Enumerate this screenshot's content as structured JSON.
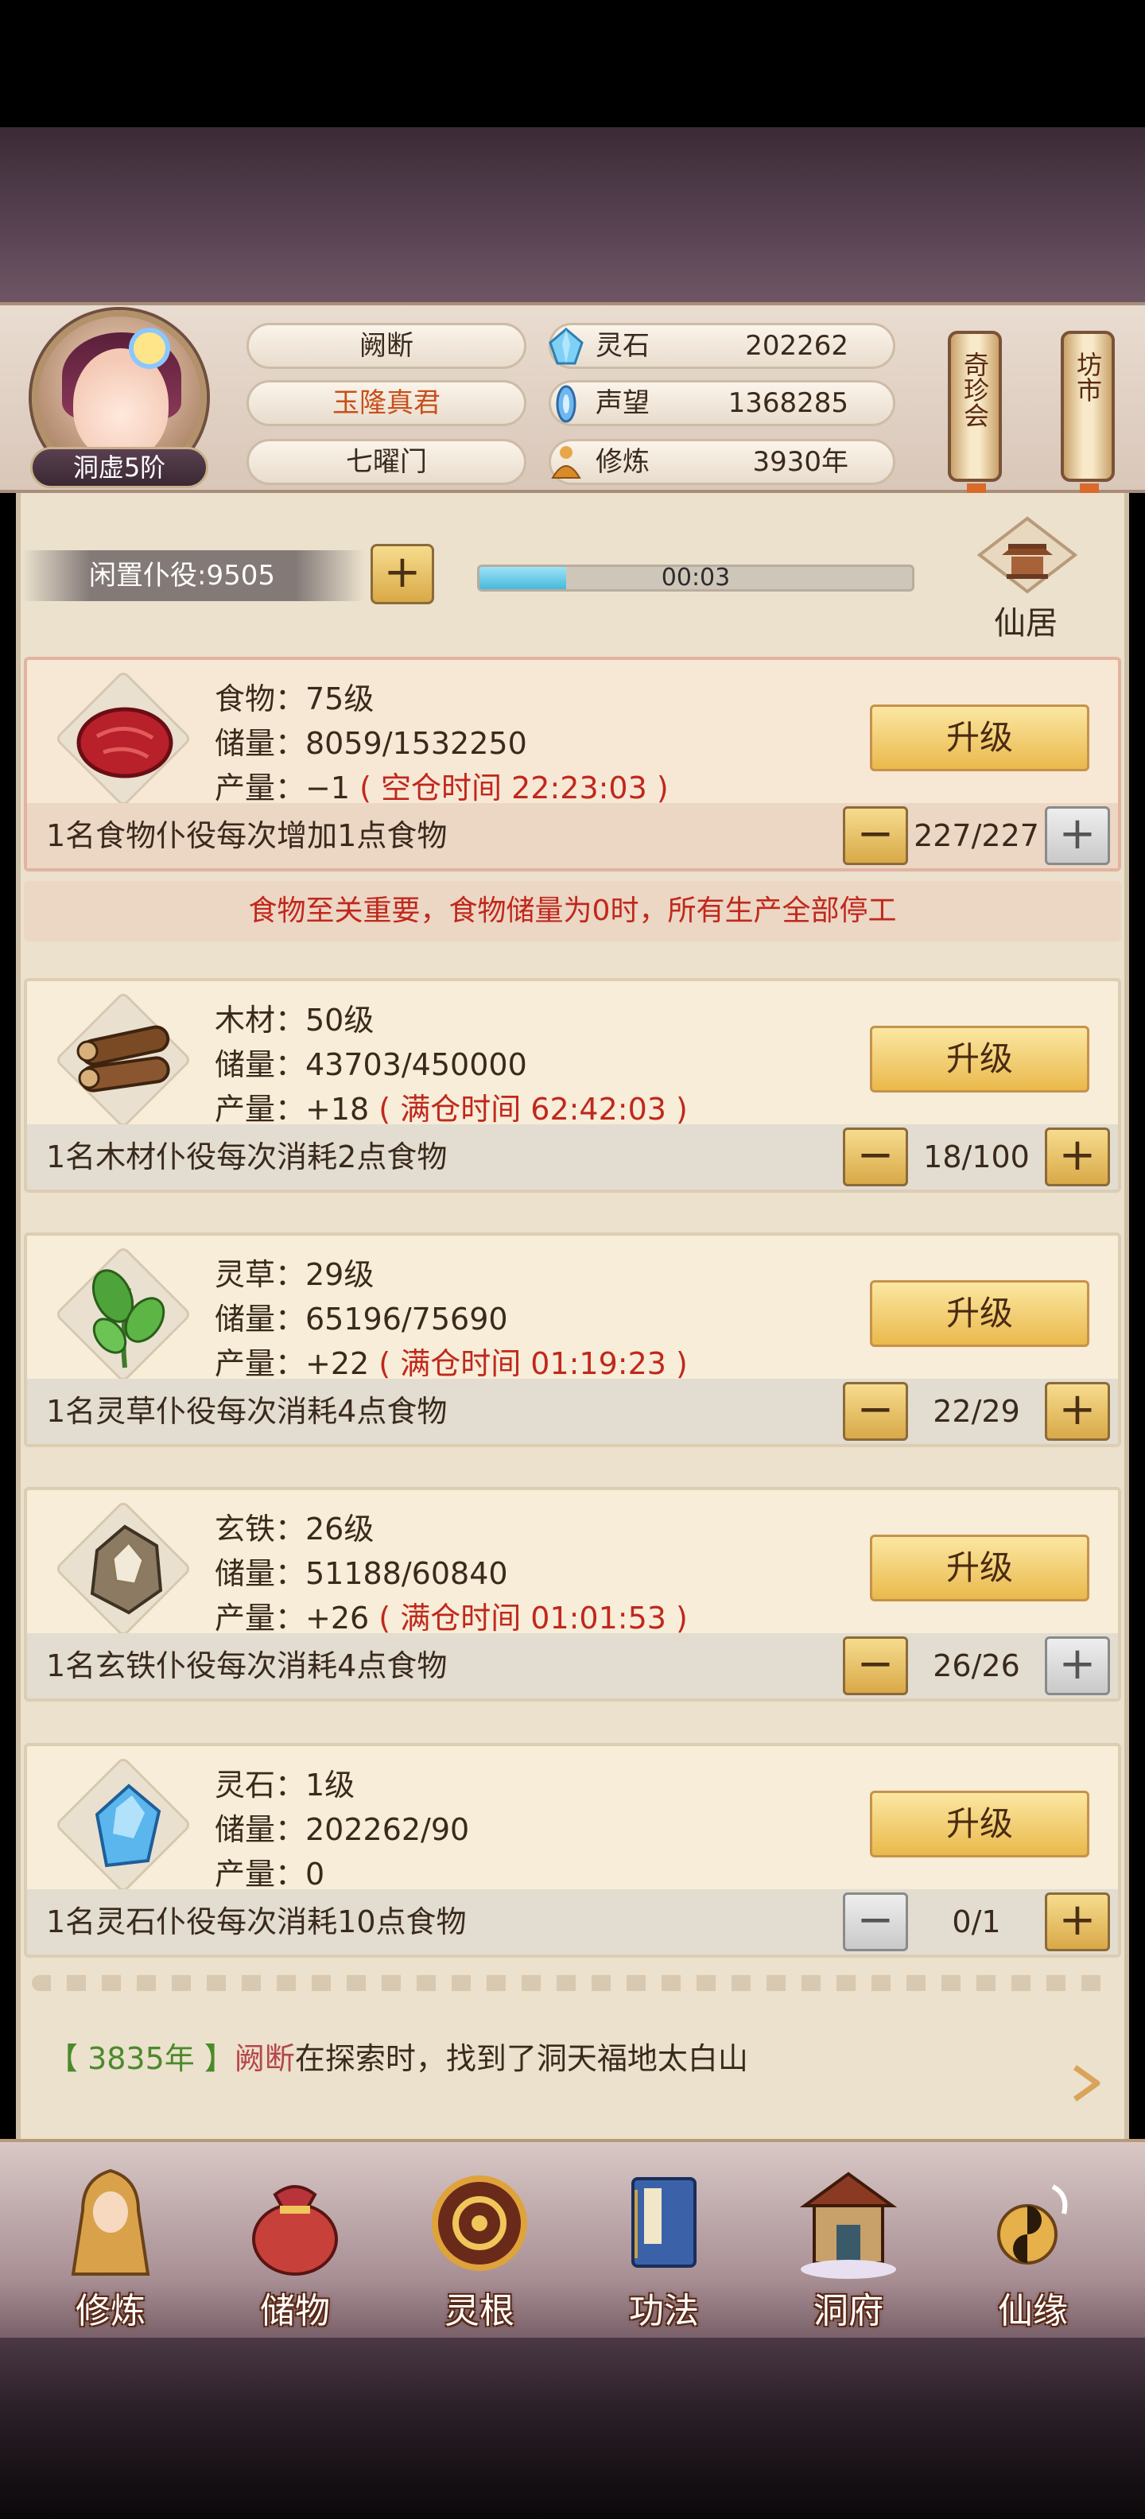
{
  "header": {
    "rank": "洞虚5阶",
    "name": "阙断",
    "title": "玉隆真君",
    "sect": "七曜门",
    "resources": [
      {
        "icon": "spirit-stone-icon",
        "label": "灵石",
        "value": "202262"
      },
      {
        "icon": "reputation-icon",
        "label": "声望",
        "value": "1368285"
      },
      {
        "icon": "cultivation-icon",
        "label": "修炼",
        "value": "3930年"
      }
    ],
    "lanterns": [
      "奇珍会",
      "坊市"
    ]
  },
  "idle": {
    "label": "闲置仆役:9505",
    "progress_time": "00:03",
    "progress_fraction": 0.2,
    "residence_label": "仙居"
  },
  "cards": [
    {
      "key": "food",
      "icon": "meat-icon",
      "level": "食物：75级",
      "storage": "储量：8059/1532250",
      "output_prefix": "产量：−1",
      "output_note": "( 空仓时间 22:23:03 )",
      "upgrade": "升级",
      "desc": "1名食物仆役每次增加1点食物",
      "count": "227/227",
      "minus_enabled": true,
      "plus_enabled": false
    },
    {
      "key": "wood",
      "icon": "wood-logs-icon",
      "level": "木材：50级",
      "storage": "储量：43703/450000",
      "output_prefix": "产量：+18",
      "output_note": "( 满仓时间 62:42:03 )",
      "upgrade": "升级",
      "desc": "1名木材仆役每次消耗2点食物",
      "count": "18/100",
      "minus_enabled": true,
      "plus_enabled": true
    },
    {
      "key": "herb",
      "icon": "herb-icon",
      "level": "灵草：29级",
      "storage": "储量：65196/75690",
      "output_prefix": "产量：+22",
      "output_note": "( 满仓时间 01:19:23 )",
      "upgrade": "升级",
      "desc": "1名灵草仆役每次消耗4点食物",
      "count": "22/29",
      "minus_enabled": true,
      "plus_enabled": true
    },
    {
      "key": "iron",
      "icon": "iron-ore-icon",
      "level": "玄铁：26级",
      "storage": "储量：51188/60840",
      "output_prefix": "产量：+26",
      "output_note": "( 满仓时间 01:01:53 )",
      "upgrade": "升级",
      "desc": "1名玄铁仆役每次消耗4点食物",
      "count": "26/26",
      "minus_enabled": true,
      "plus_enabled": false
    },
    {
      "key": "stone",
      "icon": "crystal-icon",
      "level": "灵石：1级",
      "storage": "储量：202262/90",
      "output_prefix": "产量：0",
      "output_note": "",
      "upgrade": "升级",
      "desc": "1名灵石仆役每次消耗10点食物",
      "count": "0/1",
      "minus_enabled": false,
      "plus_enabled": true
    }
  ],
  "warning": "食物至关重要，食物储量为0时，所有生产全部停工",
  "log": {
    "year": "【 3835年 】",
    "name": "阙断",
    "text": "在探索时，找到了洞天福地太白山"
  },
  "nav": [
    {
      "icon": "cultivate-icon",
      "label": "修炼"
    },
    {
      "icon": "storage-bag-icon",
      "label": "储物"
    },
    {
      "icon": "spirit-root-icon",
      "label": "灵根"
    },
    {
      "icon": "technique-book-icon",
      "label": "功法"
    },
    {
      "icon": "cave-residence-icon",
      "label": "洞府"
    },
    {
      "icon": "fortune-icon",
      "label": "仙缘"
    }
  ],
  "colors": {
    "accent_red": "#c0281c",
    "accent_green": "#4b8a2a",
    "title_orange": "#c8501a",
    "button_gold": "#eab94c"
  }
}
